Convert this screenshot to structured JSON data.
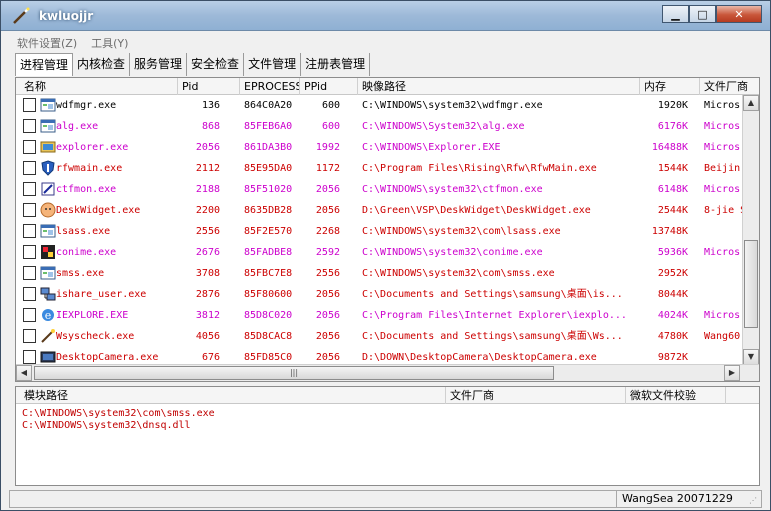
{
  "window": {
    "title": "kwluojjr"
  },
  "menu": [
    "软件设置(Z)",
    "工具(Y)"
  ],
  "tabs": [
    {
      "label": "进程管理",
      "active": true
    },
    {
      "label": "内核检查",
      "active": false
    },
    {
      "label": "服务管理",
      "active": false
    },
    {
      "label": "安全检查",
      "active": false
    },
    {
      "label": "文件管理",
      "active": false
    },
    {
      "label": "注册表管理",
      "active": false
    }
  ],
  "columns": [
    "名称",
    "Pid",
    "EPROCESS",
    "PPid",
    "映像路径",
    "内存",
    "文件厂商"
  ],
  "colors": {
    "black": "#000000",
    "red": "#cc0000",
    "magenta": "#cc00cc"
  },
  "processes": [
    {
      "name": "wdfmgr.exe",
      "pid": "136",
      "eprocess": "864C0A20",
      "ppid": "600",
      "path": "C:\\WINDOWS\\system32\\wdfmgr.exe",
      "mem": "1920K",
      "vendor": "Micros",
      "color": "black",
      "icon": "app-window-icon"
    },
    {
      "name": "alg.exe",
      "pid": "868",
      "eprocess": "85FEB6A0",
      "ppid": "600",
      "path": "C:\\WINDOWS\\System32\\alg.exe",
      "mem": "6176K",
      "vendor": "Micros",
      "color": "magenta",
      "icon": "app-window-icon"
    },
    {
      "name": "explorer.exe",
      "pid": "2056",
      "eprocess": "861DA3B0",
      "ppid": "1992",
      "path": "C:\\WINDOWS\\Explorer.EXE",
      "mem": "16488K",
      "vendor": "Micros",
      "color": "magenta",
      "icon": "explorer-icon"
    },
    {
      "name": "rfwmain.exe",
      "pid": "2112",
      "eprocess": "85E95DA0",
      "ppid": "1172",
      "path": "C:\\Program Files\\Rising\\Rfw\\RfwMain.exe",
      "mem": "1544K",
      "vendor": "Beijin",
      "color": "red",
      "icon": "shield-icon"
    },
    {
      "name": "ctfmon.exe",
      "pid": "2188",
      "eprocess": "85F51020",
      "ppid": "2056",
      "path": "C:\\WINDOWS\\system32\\ctfmon.exe",
      "mem": "6148K",
      "vendor": "Micros",
      "color": "magenta",
      "icon": "pen-icon"
    },
    {
      "name": "DeskWidget.exe",
      "pid": "2200",
      "eprocess": "8635DB28",
      "ppid": "2056",
      "path": "D:\\Green\\VSP\\DeskWidget\\DeskWidget.exe",
      "mem": "2544K",
      "vendor": "8-jie S",
      "color": "red",
      "icon": "widget-icon"
    },
    {
      "name": "lsass.exe",
      "pid": "2556",
      "eprocess": "85F2E570",
      "ppid": "2268",
      "path": "C:\\WINDOWS\\system32\\com\\lsass.exe",
      "mem": "13748K",
      "vendor": "",
      "color": "red",
      "icon": "app-window-icon"
    },
    {
      "name": "conime.exe",
      "pid": "2676",
      "eprocess": "85FADBE8",
      "ppid": "2592",
      "path": "C:\\WINDOWS\\system32\\conime.exe",
      "mem": "5936K",
      "vendor": "Micros",
      "color": "magenta",
      "icon": "ime-icon"
    },
    {
      "name": "smss.exe",
      "pid": "3708",
      "eprocess": "85FBC7E8",
      "ppid": "2556",
      "path": "C:\\WINDOWS\\system32\\com\\smss.exe",
      "mem": "2952K",
      "vendor": "",
      "color": "red",
      "icon": "app-window-icon"
    },
    {
      "name": "ishare_user.exe",
      "pid": "2876",
      "eprocess": "85F80600",
      "ppid": "2056",
      "path": "C:\\Documents and Settings\\samsung\\桌面\\is...",
      "mem": "8044K",
      "vendor": "",
      "color": "red",
      "icon": "network-icon"
    },
    {
      "name": "IEXPLORE.EXE",
      "pid": "3812",
      "eprocess": "85D8C020",
      "ppid": "2056",
      "path": "C:\\Program Files\\Internet Explorer\\iexplo...",
      "mem": "4024K",
      "vendor": "Micros",
      "color": "magenta",
      "icon": "ie-icon"
    },
    {
      "name": "Wsyscheck.exe",
      "pid": "4056",
      "eprocess": "85D8CAC8",
      "ppid": "2056",
      "path": "C:\\Documents and Settings\\samsung\\桌面\\Ws...",
      "mem": "4780K",
      "vendor": "Wang60",
      "color": "red",
      "icon": "magic-wand-icon"
    },
    {
      "name": "DesktopCamera.exe",
      "pid": "676",
      "eprocess": "85FD85C0",
      "ppid": "2056",
      "path": "D:\\DOWN\\DesktopCamera\\DesktopCamera.exe",
      "mem": "9872K",
      "vendor": "",
      "color": "red",
      "icon": "camera-icon"
    }
  ],
  "modules": {
    "columns": [
      "模块路径",
      "文件厂商",
      "微软文件校验"
    ],
    "rows": [
      "C:\\WINDOWS\\system32\\com\\smss.exe",
      "C:\\WINDOWS\\system32\\dnsq.dll"
    ]
  },
  "status": {
    "text": "WangSea 20071229"
  }
}
